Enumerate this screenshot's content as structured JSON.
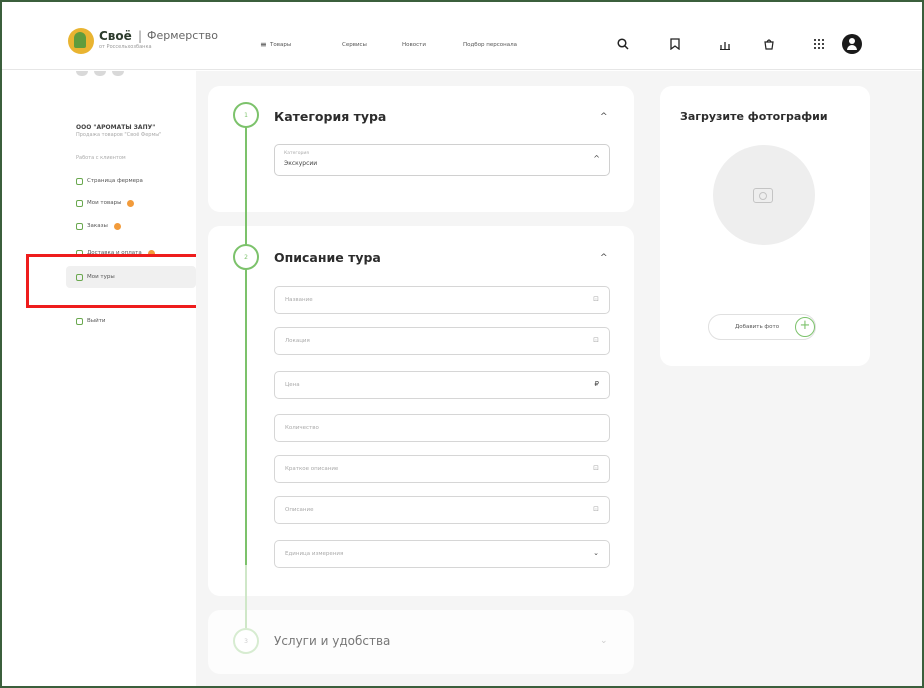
{
  "header": {
    "logo_name": "Своё",
    "logo_sep": "|",
    "logo_sub": "Фермерство",
    "logo_tagline": "от Россельхозбанка",
    "nav": [
      "Товары",
      "Сервисы",
      "Новости",
      "Подбор персонала"
    ],
    "menu_icon": "≡"
  },
  "sidebar": {
    "org_name": "ООО \"АРОМАТЫ ЗАПУ\"",
    "org_desc": "Продажа товаров \"Своё Фермы\"",
    "section_label": "Работа с клиентом",
    "items": [
      {
        "label": "Страница фермера"
      },
      {
        "label": "Мои товары"
      },
      {
        "label": "Заказы"
      },
      {
        "label": "Доставка и оплата"
      },
      {
        "label": "Мои туры"
      },
      {
        "label": "Выйти"
      }
    ]
  },
  "steps": [
    {
      "number": "1",
      "title": "Категория тура"
    },
    {
      "number": "2",
      "title": "Описание тура"
    },
    {
      "number": "3",
      "title": "Услуги и удобства"
    }
  ],
  "category_select": {
    "label": "Категория",
    "value": "Экскурсии"
  },
  "fields": [
    {
      "placeholder": "Название",
      "trail": "⊡"
    },
    {
      "placeholder": "Локация",
      "trail": "⊡"
    },
    {
      "placeholder": "Цена",
      "trail": "₽"
    },
    {
      "placeholder": "Количество",
      "trail": ""
    },
    {
      "placeholder": "Краткое описание",
      "trail": "⊡"
    },
    {
      "placeholder": "Описание",
      "trail": "⊡"
    },
    {
      "placeholder": "Единица измерения",
      "trail": "⌄"
    }
  ],
  "upload": {
    "title": "Загрузите фотографии",
    "add_label": "Добавить фото",
    "plus": "+"
  },
  "chevrons": {
    "up": "^",
    "down": "⌄"
  },
  "colors": {
    "accent_green": "#7cc26b",
    "highlight_red": "#ee1c1c",
    "badge_orange": "#f29b3b"
  }
}
